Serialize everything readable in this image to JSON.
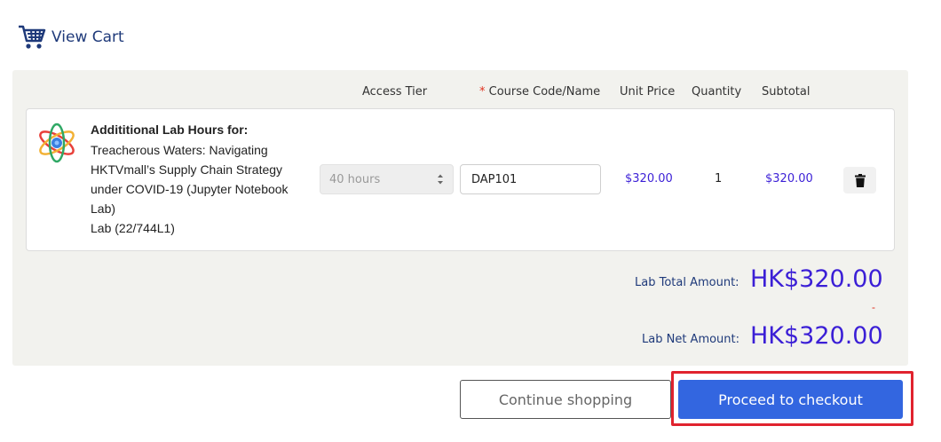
{
  "header": {
    "title": "View Cart",
    "icon": "shopping-cart-icon"
  },
  "columns": {
    "access_tier": "Access Tier",
    "course_code_required": "*",
    "course_code": " Course Code/Name",
    "unit_price": "Unit Price",
    "quantity": "Quantity",
    "subtotal": "Subtotal"
  },
  "item": {
    "icon": "atom-icon",
    "heading": "Addititional Lab Hours for:",
    "title": "Treacherous Waters: Navigating HKTVmall’s Supply Chain Strategy under COVID-19 (Jupyter Notebook Lab)",
    "code": "Lab (22/744L1)",
    "access_tier": "40 hours",
    "course_code_value": "DAP101",
    "unit_price": "$320.00",
    "quantity": "1",
    "subtotal": "$320.00"
  },
  "totals": {
    "lab_total_label": "Lab Total Amount:",
    "lab_total_value": "HK$320.00",
    "discount_marker": "-",
    "lab_net_label": "Lab Net Amount:",
    "lab_net_value": "HK$320.00"
  },
  "actions": {
    "continue_label": "Continue shopping",
    "checkout_label": "Proceed to checkout"
  },
  "colors": {
    "accent_blue": "#3366e0",
    "price_purple": "#3b1fd6",
    "highlight_red": "#e0232e",
    "header_navy": "#1f3a7a"
  }
}
